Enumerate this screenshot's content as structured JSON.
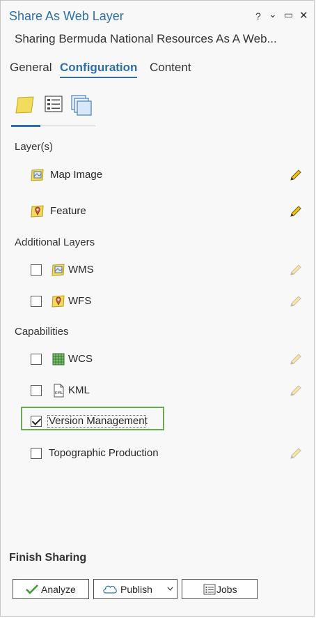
{
  "pane": {
    "title": "Share As Web Layer",
    "subtitle": "Sharing Bermuda National Resources  As A Web..."
  },
  "window_controls": {
    "help": "?",
    "menu": "⌄",
    "restore": "▭",
    "close": "✕"
  },
  "tabs": [
    {
      "label": "General",
      "active": false
    },
    {
      "label": "Configuration",
      "active": true
    },
    {
      "label": "Content",
      "active": false
    }
  ],
  "sections": {
    "layers": "Layer(s)",
    "additional": "Additional Layers",
    "capabilities": "Capabilities"
  },
  "layers": [
    {
      "label": "Map Image",
      "icon": "map-image-icon"
    },
    {
      "label": "Feature",
      "icon": "feature-layer-icon"
    }
  ],
  "additional_layers": [
    {
      "label": "WMS",
      "checked": false,
      "icon": "map-image-icon"
    },
    {
      "label": "WFS",
      "checked": false,
      "icon": "feature-layer-icon"
    }
  ],
  "capabilities": [
    {
      "label": "WCS",
      "checked": false,
      "icon": "raster-grid-icon"
    },
    {
      "label": "KML",
      "checked": false,
      "icon": "kml-file-icon"
    },
    {
      "label": "Version Management",
      "checked": true
    },
    {
      "label": "Topographic Production",
      "checked": false
    }
  ],
  "finish": {
    "heading": "Finish Sharing",
    "analyze": "Analyze",
    "publish": "Publish",
    "jobs": "Jobs"
  },
  "colors": {
    "accent": "#2e6fa7",
    "highlight": "#6aa84f",
    "layer_yellow": "#f2dc5d"
  }
}
